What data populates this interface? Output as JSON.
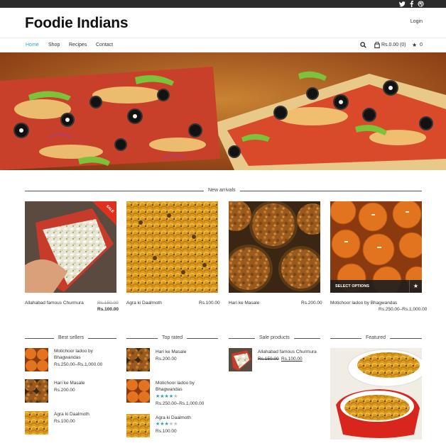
{
  "colors": {
    "topbar": "#2b2b2b",
    "accent": "#2aa6c5",
    "sale": "#e0301e",
    "stars": "#2aa6a6"
  },
  "social_icons": [
    "twitter-icon",
    "facebook-icon",
    "dribbble-icon"
  ],
  "header": {
    "logo": "Foodie Indians",
    "login": "Login"
  },
  "nav": {
    "items": [
      "Home",
      "Shop",
      "Recipes",
      "Contact"
    ],
    "cart": "Rs.0.00 (0)",
    "wishlist_count": "0"
  },
  "new_arrivals": {
    "title": "New arrivals",
    "products": [
      {
        "name": "Allahabad famous Churmura",
        "old_price": "Rs.150.00",
        "price": "Rs.100.00",
        "badge": "SALE"
      },
      {
        "name": "Agra ki Daalmoth",
        "price": "Rs.100.00"
      },
      {
        "name": "Hari ke Masale",
        "price": "Rs.200.00"
      },
      {
        "name": "Motichoor ladoo by Bhagwandas",
        "price": "Rs.250.00–Rs.1,000.00",
        "button": "SELECT OPTIONS"
      }
    ]
  },
  "best_sellers": {
    "title": "Best sellers",
    "items": [
      {
        "name": "Motichoor ladoo by Bhagwandas",
        "price": "Rs.250.00–Rs.1,000.00"
      },
      {
        "name": "Hari ke Masale",
        "price": "Rs.200.00"
      },
      {
        "name": "Agra ki Daalmoth",
        "price": "Rs.100.00"
      }
    ]
  },
  "top_rated": {
    "title": "Top rated",
    "items": [
      {
        "name": "Hari ke Masale",
        "price": "Rs.200.00",
        "rating": 0
      },
      {
        "name": "Motichoor ladoo by Bhagwandas",
        "price": "Rs.250.00–Rs.1,000.00",
        "rating": 4
      },
      {
        "name": "Agra ki Daalmoth",
        "price": "Rs.100.00",
        "rating": 3
      }
    ]
  },
  "sale_products": {
    "title": "Sale products",
    "items": [
      {
        "name": "Allahabad famous Churmura",
        "old_price": "Rs.150.00",
        "price": "Rs.100.00"
      }
    ]
  },
  "featured": {
    "title": "Featured"
  }
}
